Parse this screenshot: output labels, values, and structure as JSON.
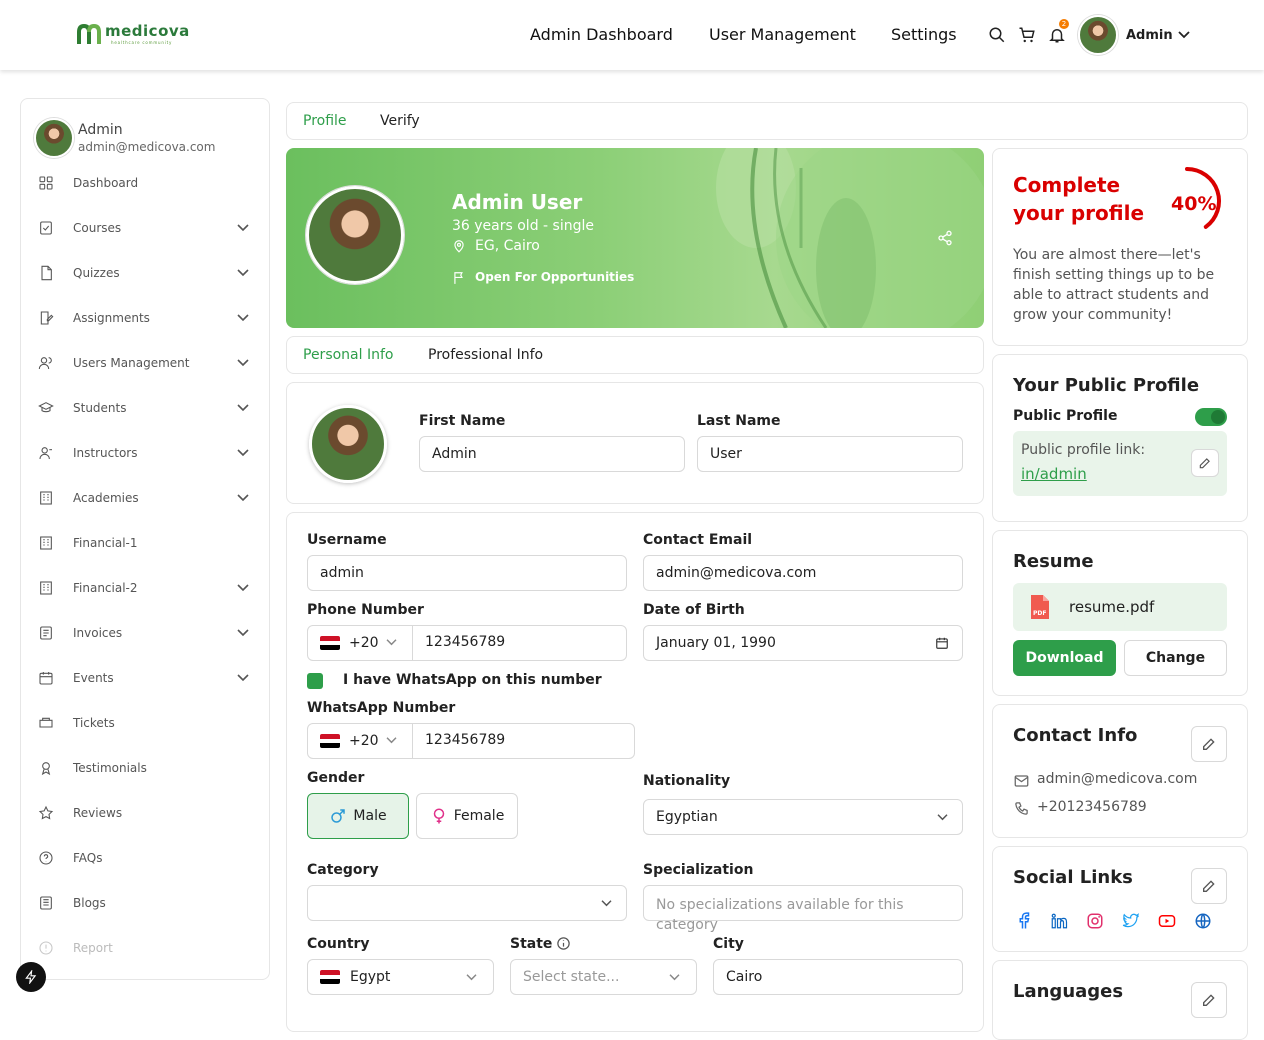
{
  "brand": {
    "name": "medicova",
    "tagline": "healthcare community"
  },
  "nav": {
    "items": [
      "Admin Dashboard",
      "User Management",
      "Settings"
    ],
    "notification_count": "2",
    "user": "Admin"
  },
  "sidebar": {
    "user": {
      "name": "Admin",
      "email": "admin@medicova.com"
    },
    "items": [
      {
        "label": "Dashboard"
      },
      {
        "label": "Courses"
      },
      {
        "label": "Quizzes"
      },
      {
        "label": "Assignments"
      },
      {
        "label": "Users Management"
      },
      {
        "label": "Students"
      },
      {
        "label": "Instructors"
      },
      {
        "label": "Academies"
      },
      {
        "label": "Financial-1"
      },
      {
        "label": "Financial-2"
      },
      {
        "label": "Invoices"
      },
      {
        "label": "Events"
      },
      {
        "label": "Tickets"
      },
      {
        "label": "Testimonials"
      },
      {
        "label": "Reviews"
      },
      {
        "label": "FAQs"
      },
      {
        "label": "Blogs"
      },
      {
        "label": "Report"
      }
    ]
  },
  "tabs": {
    "profile": "Profile",
    "verify": "Verify"
  },
  "banner": {
    "name": "Admin User",
    "age": "36 years old - single",
    "location": "EG, Cairo",
    "status": "Open For Opportunities"
  },
  "subtabs": {
    "personal": "Personal Info",
    "professional": "Professional Info"
  },
  "form": {
    "first_name_label": "First Name",
    "first_name": "Admin",
    "last_name_label": "Last Name",
    "last_name": "User",
    "username_label": "Username",
    "username": "admin",
    "email_label": "Contact Email",
    "email": "admin@medicova.com",
    "phone_label": "Phone Number",
    "phone_code": "+20",
    "phone": "123456789",
    "dob_label": "Date of Birth",
    "dob": "January 01, 1990",
    "whatsapp_check": "I have WhatsApp on this number",
    "whatsapp_label": "WhatsApp Number",
    "whatsapp_code": "+20",
    "whatsapp": "123456789",
    "gender_label": "Gender",
    "male": "Male",
    "female": "Female",
    "nationality_label": "Nationality",
    "nationality": "Egyptian",
    "category_label": "Category",
    "specialization_label": "Specialization",
    "specialization_placeholder": "No specializations available for this category",
    "country_label": "Country",
    "country": "Egypt",
    "state_label": "State",
    "state_placeholder": "Select state...",
    "city_label": "City",
    "city": "Cairo"
  },
  "complete": {
    "title_line1": "Complete",
    "title_line2": "your profile",
    "percent": "40%",
    "percent_value": 0.4,
    "text": "You are almost there—let's finish setting things up to be able to attract students and grow your community!"
  },
  "public_profile": {
    "title": "Your Public Profile",
    "toggle_label": "Public Profile",
    "link_label": "Public profile link:",
    "link": "in/admin"
  },
  "resume": {
    "title": "Resume",
    "file": "resume.pdf",
    "download": "Download",
    "change": "Change"
  },
  "contact": {
    "title": "Contact Info",
    "email": "admin@medicova.com",
    "phone": "+20123456789"
  },
  "social": {
    "title": "Social Links",
    "icons": [
      "facebook-icon",
      "linkedin-icon",
      "instagram-icon",
      "twitter-icon",
      "youtube-icon",
      "globe-icon"
    ]
  },
  "languages": {
    "title": "Languages"
  },
  "colors": {
    "brand": "#2e9e4a",
    "accent_red": "#d90000",
    "light_green": "#e9f4ea"
  }
}
